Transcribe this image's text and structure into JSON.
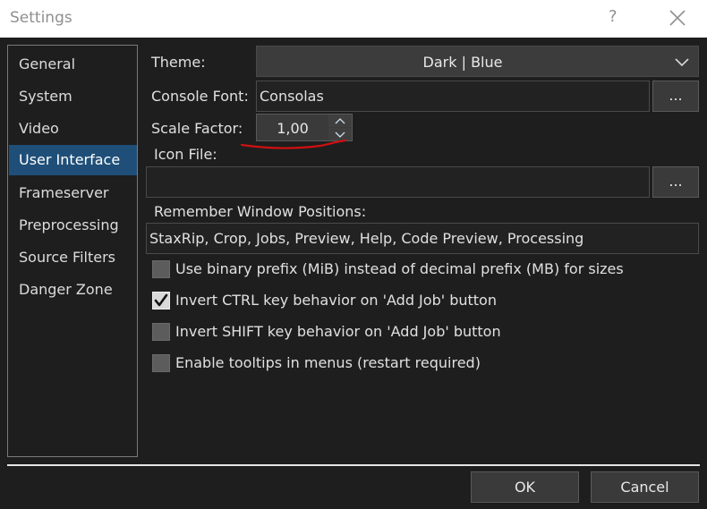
{
  "window": {
    "title": "Settings",
    "help_label": "?"
  },
  "sidebar": {
    "items": [
      {
        "label": "General",
        "active": false
      },
      {
        "label": "System",
        "active": false
      },
      {
        "label": "Video",
        "active": false
      },
      {
        "label": "User Interface",
        "active": true
      },
      {
        "label": "Frameserver",
        "active": false
      },
      {
        "label": "Preprocessing",
        "active": false
      },
      {
        "label": "Source Filters",
        "active": false
      },
      {
        "label": "Danger Zone",
        "active": false
      }
    ]
  },
  "form": {
    "theme_label": "Theme:",
    "theme_value": "Dark | Blue",
    "console_font_label": "Console Font:",
    "console_font_value": "Consolas",
    "browse_label": "...",
    "scale_factor_label": "Scale Factor:",
    "scale_factor_value": "1,00",
    "icon_file_label": "Icon File:",
    "icon_file_value": "",
    "remember_label": "Remember Window Positions:",
    "remember_value": "StaxRip, Crop, Jobs, Preview, Help, Code Preview, Processing"
  },
  "checkboxes": [
    {
      "label": "Use binary prefix (MiB) instead of decimal prefix (MB) for sizes",
      "checked": false
    },
    {
      "label": "Invert CTRL key behavior on 'Add Job' button",
      "checked": true
    },
    {
      "label": "Invert SHIFT key behavior on 'Add Job' button",
      "checked": false
    },
    {
      "label": "Enable tooltips in menus (restart required)",
      "checked": false
    }
  ],
  "footer": {
    "ok_label": "OK",
    "cancel_label": "Cancel"
  },
  "colors": {
    "accent": "#1f4f78",
    "annotation": "#d01010"
  },
  "icons": [
    "close-icon",
    "chevron-down-icon",
    "spin-up-icon",
    "spin-down-icon",
    "checkmark-icon"
  ]
}
